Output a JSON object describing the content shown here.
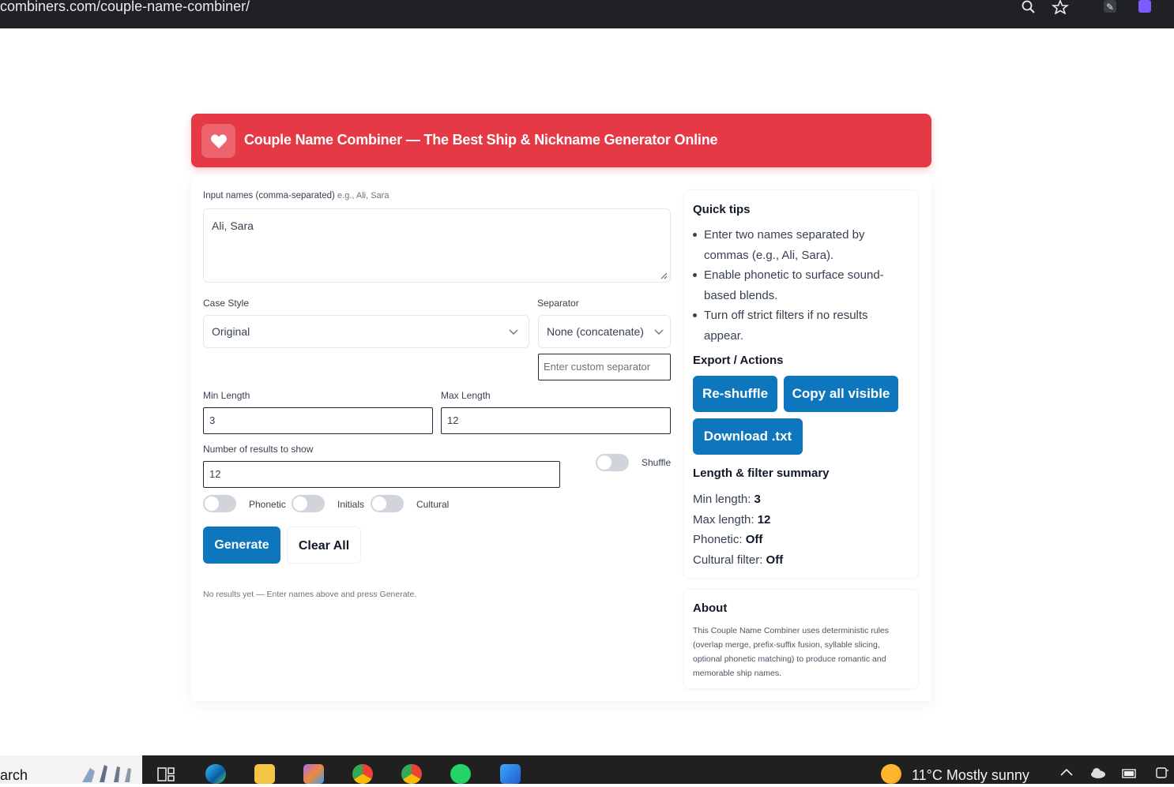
{
  "browser": {
    "url": "combiners.com/couple-name-combiner/"
  },
  "header": {
    "title": "Couple Name Combiner — The Best Ship & Nickname Generator Online"
  },
  "form": {
    "input_label": "Input names (comma-separated)",
    "input_hint": "e.g., Ali, Sara",
    "input_value": "Ali, Sara",
    "case_style_label": "Case Style",
    "case_style_value": "Original",
    "separator_label": "Separator",
    "separator_value": "None (concatenate)",
    "custom_separator_placeholder": "Enter custom separator",
    "min_length_label": "Min Length",
    "min_length_value": "3",
    "max_length_label": "Max Length",
    "max_length_value": "12",
    "num_results_label": "Number of results to show",
    "num_results_value": "12",
    "shuffle_label": "Shuffle",
    "phonetic_label": "Phonetic",
    "initials_label": "Initials",
    "cultural_label": "Cultural",
    "generate_label": "Generate",
    "clear_label": "Clear All",
    "status_text": "No results yet — Enter names above and press Generate."
  },
  "sidebar": {
    "tips_title": "Quick tips",
    "tips": [
      "Enter two names separated by commas (e.g., Ali, Sara).",
      "Enable phonetic to surface sound-based blends.",
      "Turn off strict filters if no results appear."
    ],
    "actions_title": "Export / Actions",
    "reshuffle_label": "Re-shuffle",
    "copy_label": "Copy all visible",
    "download_label": "Download .txt",
    "summary_title": "Length & filter summary",
    "summary": {
      "min_label": "Min length:",
      "min_value": "3",
      "max_label": "Max length:",
      "max_value": "12",
      "phonetic_label": "Phonetic:",
      "phonetic_value": "Off",
      "cultural_label": "Cultural filter:",
      "cultural_value": "Off"
    },
    "about_title": "About",
    "about_text": "This Couple Name Combiner uses deterministic rules (overlap merge, prefix-suffix fusion, syllable slicing, optional phonetic matching) to produce romantic and memorable ship names."
  },
  "taskbar": {
    "search_fragment": "arch",
    "weather": "11°C  Mostly sunny"
  },
  "colors": {
    "brand_red": "#e63946",
    "primary_blue": "#0e76bc"
  }
}
